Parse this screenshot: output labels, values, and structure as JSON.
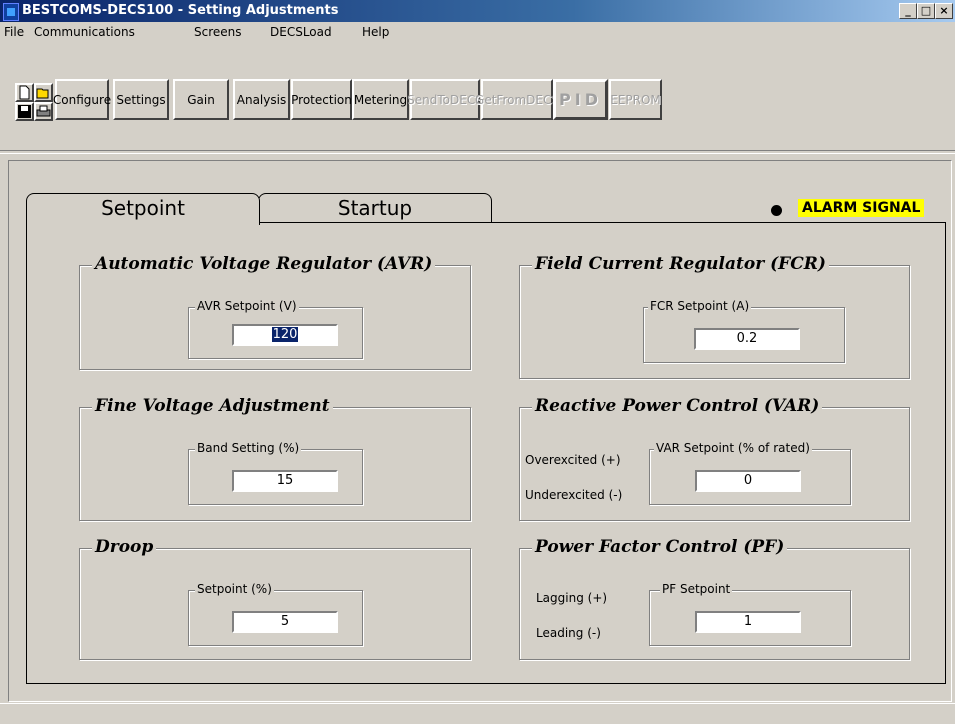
{
  "window": {
    "title": "BESTCOMS-DECS100 - Setting Adjustments",
    "min": "_",
    "max": "□",
    "close": "×"
  },
  "menu": [
    "File",
    "Communications",
    "Screens",
    "DECSLoad",
    "Help"
  ],
  "toolbar": {
    "buttons": [
      "Configure",
      "Settings",
      "Gain",
      "Analysis",
      "Protection",
      "Metering",
      "SendToDECS",
      "GetFromDECS",
      "PID",
      "EEPROM"
    ]
  },
  "tabs": [
    "Setpoint",
    "Startup"
  ],
  "alarm": "ALARM SIGNAL",
  "avr": {
    "title": "Automatic Voltage Regulator (AVR)",
    "sub": "AVR Setpoint (V)",
    "value": "120"
  },
  "fine": {
    "title": "Fine Voltage Adjustment",
    "sub": "Band Setting (%)",
    "value": "15"
  },
  "droop": {
    "title": "Droop",
    "sub": "Setpoint (%)",
    "value": "5"
  },
  "fcr": {
    "title": "Field Current Regulator (FCR)",
    "sub": "FCR Setpoint (A)",
    "value": "0.2"
  },
  "var": {
    "title": "Reactive Power Control (VAR)",
    "sub": "VAR Setpoint (% of rated)",
    "value": "0",
    "over": "Overexcited (+)",
    "under": "Underexcited (-)"
  },
  "pf": {
    "title": "Power Factor Control (PF)",
    "sub": "PF Setpoint",
    "value": "1",
    "lag": "Lagging (+)",
    "lead": "Leading (-)"
  }
}
